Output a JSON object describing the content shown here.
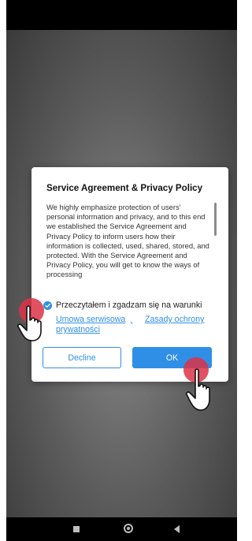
{
  "dialog": {
    "title": "Service Agreement & Privacy Policy",
    "body": "We highly emphasize protection of users' personal information and privacy, and to this end we established the Service Agreement and Privacy Policy to inform users how their information is collected, used, shared, stored, and protected. With the Service Agreement and Privacy Policy, you will get to know the ways of processing",
    "consent_text": "Przeczytałem i zgadzam się na warunki",
    "link_service": "Umowa serwisowa",
    "link_separator": "、",
    "link_privacy_1": "Zasady ochrony",
    "link_privacy_2": "prywatności",
    "decline_label": "Decline",
    "ok_label": "OK",
    "consent_checked": true
  },
  "colors": {
    "accent": "#2f8fe6",
    "tap_marker": "#dc3246",
    "backdrop": "#6f6f6f"
  },
  "icons": {
    "checkbox": "check-circle-icon",
    "nav_recents": "square-icon",
    "nav_home": "circle-icon",
    "nav_back": "triangle-back-icon",
    "pointer": "pointing-hand-icon"
  }
}
